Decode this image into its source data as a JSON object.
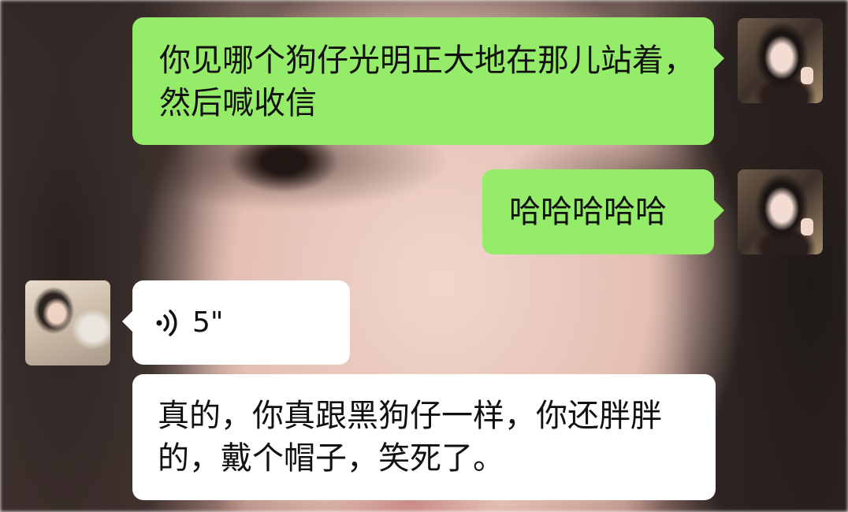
{
  "messages": {
    "m1": {
      "sender": "me",
      "text": "你见哪个狗仔光明正大地在那儿站着，然后喊收信"
    },
    "m2": {
      "sender": "me",
      "text": "哈哈哈哈哈"
    },
    "m3": {
      "sender": "other",
      "type": "voice",
      "duration": "5\""
    },
    "m4": {
      "sender": "other",
      "text": "真的，你真跟黑狗仔一样，你还胖胖的，戴个帽子，笑死了。"
    }
  },
  "colors": {
    "outgoing_bubble": "#95ec69",
    "incoming_bubble": "#ffffff",
    "text": "#111111"
  },
  "icons": {
    "voice": "voice-wave-icon"
  }
}
